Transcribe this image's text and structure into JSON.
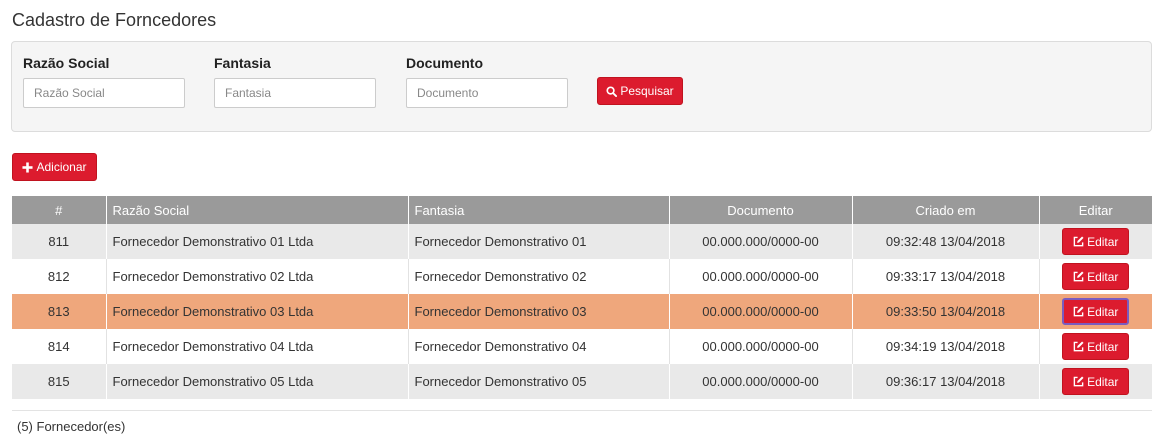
{
  "page": {
    "title": "Cadastro de Forncedores"
  },
  "filters": {
    "razao_social": {
      "label": "Razão Social",
      "placeholder": "Razão Social",
      "value": ""
    },
    "fantasia": {
      "label": "Fantasia",
      "placeholder": "Fantasia",
      "value": ""
    },
    "documento": {
      "label": "Documento",
      "placeholder": "Documento",
      "value": ""
    },
    "search_label": "Pesquisar"
  },
  "toolbar": {
    "add_label": "Adicionar"
  },
  "table": {
    "headers": [
      "#",
      "Razão Social",
      "Fantasia",
      "Documento",
      "Criado em",
      "Editar"
    ],
    "rows": [
      {
        "id": "811",
        "razao": "Fornecedor Demonstrativo 01 Ltda",
        "fantasia": "Fornecedor Demonstrativo 01",
        "documento": "00.000.000/0000-00",
        "criado": "09:32:48 13/04/2018",
        "edit_label": "Editar"
      },
      {
        "id": "812",
        "razao": "Fornecedor Demonstrativo 02 Ltda",
        "fantasia": "Fornecedor Demonstrativo 02",
        "documento": "00.000.000/0000-00",
        "criado": "09:33:17 13/04/2018",
        "edit_label": "Editar"
      },
      {
        "id": "813",
        "razao": "Fornecedor Demonstrativo 03 Ltda",
        "fantasia": "Fornecedor Demonstrativo 03",
        "documento": "00.000.000/0000-00",
        "criado": "09:33:50 13/04/2018",
        "edit_label": "Editar"
      },
      {
        "id": "814",
        "razao": "Fornecedor Demonstrativo 04 Ltda",
        "fantasia": "Fornecedor Demonstrativo 04",
        "documento": "00.000.000/0000-00",
        "criado": "09:34:19 13/04/2018",
        "edit_label": "Editar"
      },
      {
        "id": "815",
        "razao": "Fornecedor Demonstrativo 05 Ltda",
        "fantasia": "Fornecedor Demonstrativo 05",
        "documento": "00.000.000/0000-00",
        "criado": "09:36:17 13/04/2018",
        "edit_label": "Editar"
      }
    ],
    "selected_row": 2
  },
  "footer": {
    "count_text": "(5) Fornecedor(es)"
  },
  "colors": {
    "accent": "#dc1b2e",
    "header_bg": "#9a9a9a",
    "selected_row": "#efa77c",
    "odd_row": "#e9e9e9"
  },
  "icons": {
    "search": "search-icon",
    "add": "plus-icon",
    "edit": "edit-icon"
  }
}
